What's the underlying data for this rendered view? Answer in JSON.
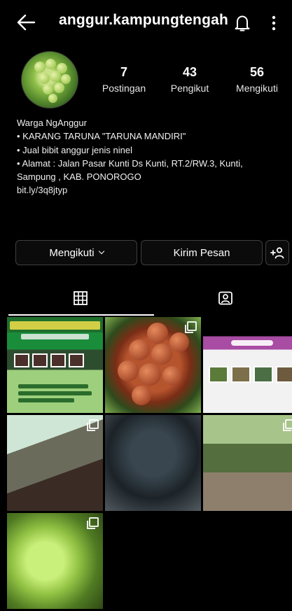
{
  "header": {
    "username": "anggur.kampungtengah",
    "back_icon": "arrow-left-icon",
    "notifications_icon": "bell-icon",
    "menu_icon": "more-vertical-icon"
  },
  "profile": {
    "stats": [
      {
        "value": "7",
        "label": "Postingan"
      },
      {
        "value": "43",
        "label": "Pengikut"
      },
      {
        "value": "56",
        "label": "Mengikuti"
      }
    ],
    "bio": [
      "Warga NgAnggur",
      "• KARANG TARUNA \"TARUNA MANDIRI\"",
      "• Jual bibit anggur jenis ninel",
      "• Alamat : Jalan Pasar Kunti Ds Kunti, RT.2/RW.3, Kunti,",
      "Sampung , KAB. PONOROGO"
    ],
    "link": "bit.ly/3q8jtyp"
  },
  "actions": {
    "following_label": "Mengikuti",
    "message_label": "Kirim Pesan",
    "add_person_icon": "add-person-icon"
  },
  "tabs": {
    "grid_icon": "grid-icon",
    "tagged_icon": "tagged-person-icon"
  },
  "posts": [
    {
      "kind": "poster",
      "multi": false
    },
    {
      "kind": "red-grapes",
      "multi": true
    },
    {
      "kind": "promo-banner",
      "multi": false
    },
    {
      "kind": "grape-vine",
      "multi": true
    },
    {
      "kind": "group-meeting",
      "multi": false
    },
    {
      "kind": "vineyard",
      "multi": true
    },
    {
      "kind": "green-grapes",
      "multi": true
    }
  ]
}
